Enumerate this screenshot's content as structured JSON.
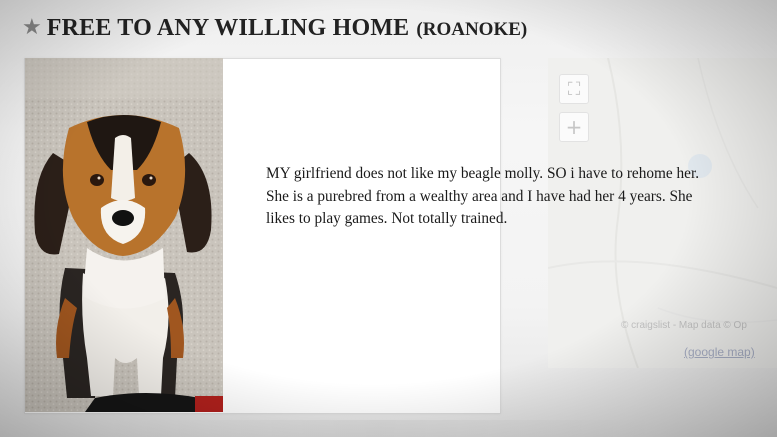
{
  "header": {
    "star_icon": "star-icon",
    "title": "FREE TO ANY WILLING HOME",
    "location": "(ROANOKE)"
  },
  "photo": {
    "subject": "beagle-photo"
  },
  "body": {
    "lines": [
      "MY girlfriend does not like my beagle molly. SO i have to rehome her.",
      "She is a purebred from a wealthy area and I have had her 4 years. She",
      "likes to play games. Not totally trained."
    ]
  },
  "map": {
    "fullscreen_icon": "fullscreen-icon",
    "zoom_icon": "zoom-in-icon",
    "zoom_glyph": "+",
    "credit": "© craigslist - Map data © Op",
    "link": "(google map)"
  },
  "colors": {
    "title_text": "#222222",
    "body_text": "#1a1a1a",
    "link": "#a9b0c6",
    "star": "#8a8a8a"
  }
}
